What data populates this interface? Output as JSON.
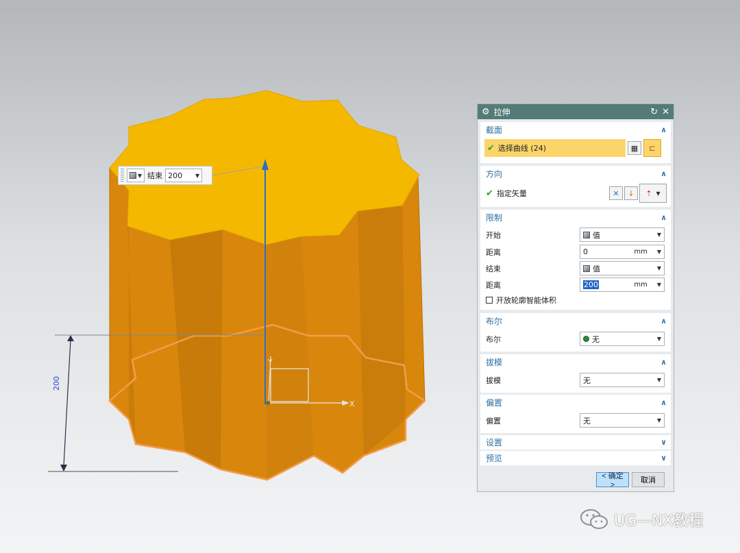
{
  "floating_input": {
    "label": "结束",
    "value": "200",
    "type_icon": "value-cube-icon"
  },
  "viewport": {
    "dimension_text": "200",
    "axis_x": "X",
    "axis_y": "Y",
    "part_color": "#f5b800",
    "side_color": "#d9870c",
    "edge_color": "#f59b4a"
  },
  "dialog": {
    "title": "拉伸",
    "title_icon": "gear-icon",
    "section": {
      "title": "截面",
      "select_curve": "选择曲线 (24)"
    },
    "direction": {
      "title": "方向",
      "specify_vector": "指定矢量"
    },
    "limits": {
      "title": "限制",
      "start_label": "开始",
      "start_value": "值",
      "start_distance_label": "距离",
      "start_distance": "0",
      "start_unit": "mm",
      "end_label": "结束",
      "end_value": "值",
      "end_distance_label": "距离",
      "end_distance": "200",
      "end_unit": "mm",
      "open_profile": "开放轮廓智能体积"
    },
    "boolean": {
      "title": "布尔",
      "label": "布尔",
      "value": "无"
    },
    "draft": {
      "title": "拔模",
      "label": "拔模",
      "value": "无"
    },
    "offset": {
      "title": "偏置",
      "label": "偏置",
      "value": "无"
    },
    "settings": {
      "title": "设置"
    },
    "preview": {
      "title": "预览"
    },
    "ok": "< 确定 >",
    "cancel": "取消"
  },
  "watermark": "UG—NX教程",
  "colors": {
    "title_bar": "#557b78",
    "section_title": "#2f6fa1",
    "selected_row": "#fbd56a",
    "ok_button": "#bfe0f8"
  }
}
